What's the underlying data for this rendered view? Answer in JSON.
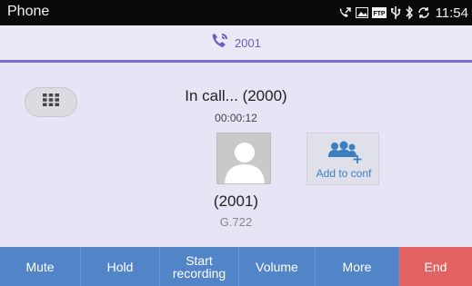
{
  "status_bar": {
    "app_title": "Phone",
    "time": "11:54",
    "icons": [
      "call-forward-icon",
      "image-icon",
      "ftp-icon",
      "usb-icon",
      "bluetooth-icon",
      "sync-icon"
    ]
  },
  "header": {
    "line_number": "2001",
    "icon": "phone-call-icon"
  },
  "call": {
    "status": "In call... (2000)",
    "timer": "00:00:12",
    "remote_number": "(2001)",
    "codec": "G.722"
  },
  "dialpad": {
    "icon": "dialpad-icon"
  },
  "add_to_conf": {
    "label": "Add to conf",
    "icon": "add-group-icon"
  },
  "actions": {
    "mute": "Mute",
    "hold": "Hold",
    "start_recording_line1": "Start",
    "start_recording_line2": "recording",
    "volume": "Volume",
    "more": "More",
    "end": "End"
  },
  "colors": {
    "accent": "#7a6fd0",
    "action_bar": "#5284c8",
    "end_button": "#e36363",
    "link": "#3c7fc0"
  }
}
